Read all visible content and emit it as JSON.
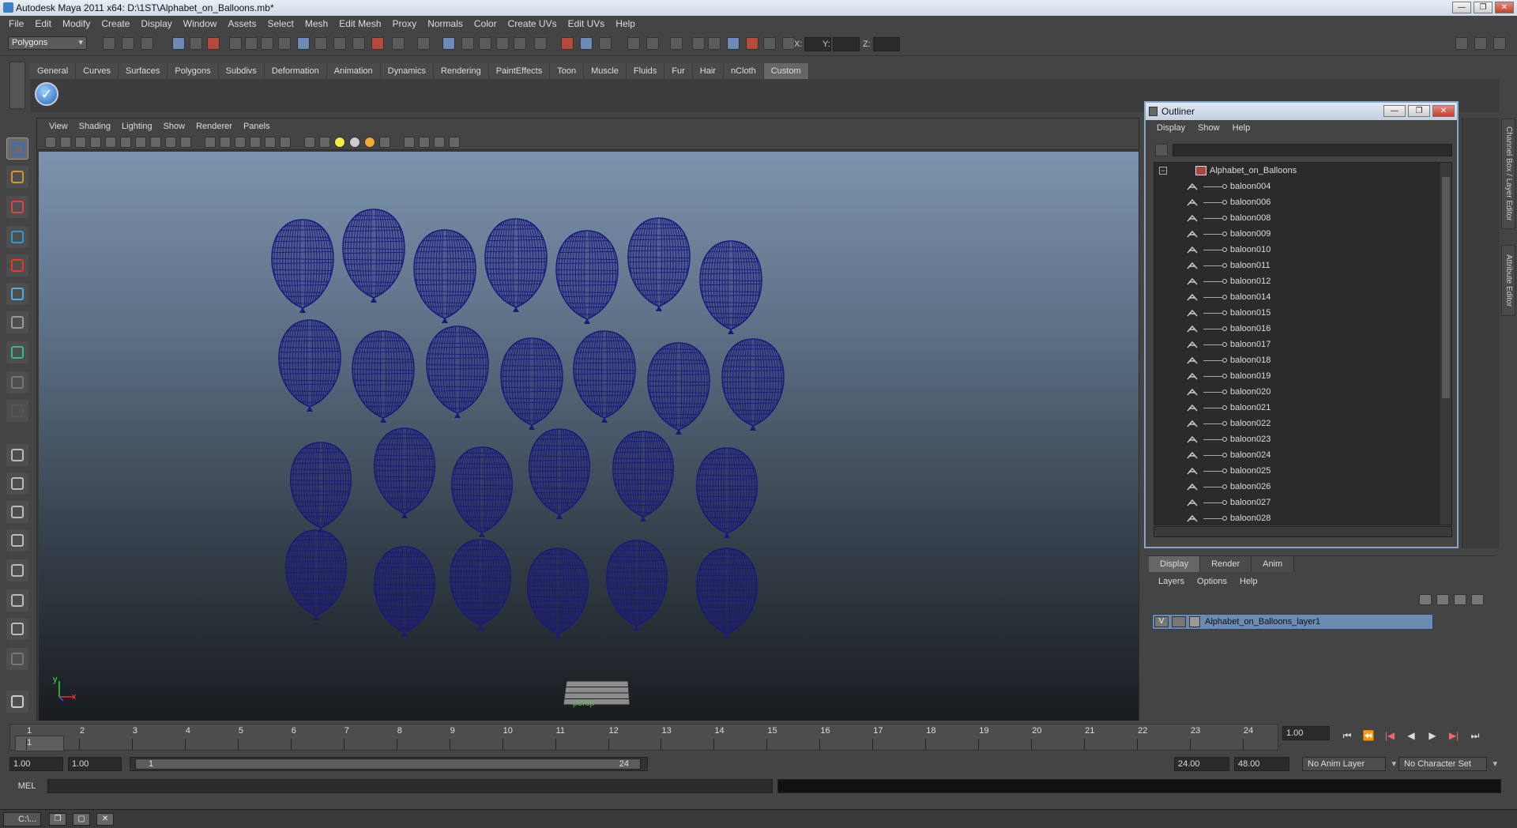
{
  "window": {
    "title": "Autodesk Maya 2011 x64: D:\\1ST\\Alphabet_on_Balloons.mb*"
  },
  "menu": [
    "File",
    "Edit",
    "Modify",
    "Create",
    "Display",
    "Window",
    "Assets",
    "Select",
    "Mesh",
    "Edit Mesh",
    "Proxy",
    "Normals",
    "Color",
    "Create UVs",
    "Edit UVs",
    "Help"
  ],
  "status": {
    "mode": "Polygons",
    "x_label": "X:",
    "y_label": "Y:",
    "z_label": "Z:"
  },
  "shelf": {
    "tabs": [
      "General",
      "Curves",
      "Surfaces",
      "Polygons",
      "Subdivs",
      "Deformation",
      "Animation",
      "Dynamics",
      "Rendering",
      "PaintEffects",
      "Toon",
      "Muscle",
      "Fluids",
      "Fur",
      "Hair",
      "nCloth",
      "Custom"
    ],
    "active": "Custom"
  },
  "viewport": {
    "menu": [
      "View",
      "Shading",
      "Lighting",
      "Show",
      "Renderer",
      "Panels"
    ],
    "camera": "persp",
    "axis_y": "y",
    "axis_x": "x",
    "wire_color": "#1a1a7a"
  },
  "outliner": {
    "title": "Outliner",
    "menu": [
      "Display",
      "Show",
      "Help"
    ],
    "root": "Alphabet_on_Balloons",
    "items": [
      "baloon004",
      "baloon006",
      "baloon008",
      "baloon009",
      "baloon010",
      "baloon011",
      "baloon012",
      "baloon014",
      "baloon015",
      "baloon016",
      "baloon017",
      "baloon018",
      "baloon019",
      "baloon020",
      "baloon021",
      "baloon022",
      "baloon023",
      "baloon024",
      "baloon025",
      "baloon026",
      "baloon027",
      "baloon028"
    ]
  },
  "side_tabs": {
    "channel": "Channel Box / Layer Editor",
    "attribute": "Attribute Editor"
  },
  "layers": {
    "tabs": [
      "Display",
      "Render",
      "Anim"
    ],
    "active": "Display",
    "menu": [
      "Layers",
      "Options",
      "Help"
    ],
    "layer_name": "Alphabet_on_Balloons_layer1",
    "visible_flag": "V"
  },
  "timeline": {
    "ticks": [
      "1",
      "2",
      "3",
      "4",
      "5",
      "6",
      "7",
      "8",
      "9",
      "10",
      "11",
      "12",
      "13",
      "14",
      "15",
      "16",
      "17",
      "18",
      "19",
      "20",
      "21",
      "22",
      "23",
      "24"
    ],
    "current_frame": "1",
    "current_time_field": "1.00"
  },
  "range": {
    "start": "1.00",
    "anim_start": "1.00",
    "range_start": "1",
    "range_end": "24",
    "anim_end": "24.00",
    "end": "48.00",
    "anim_layer": "No Anim Layer",
    "char_set": "No Character Set"
  },
  "command": {
    "label": "MEL"
  },
  "taskbar": {
    "item": "C:\\..."
  }
}
